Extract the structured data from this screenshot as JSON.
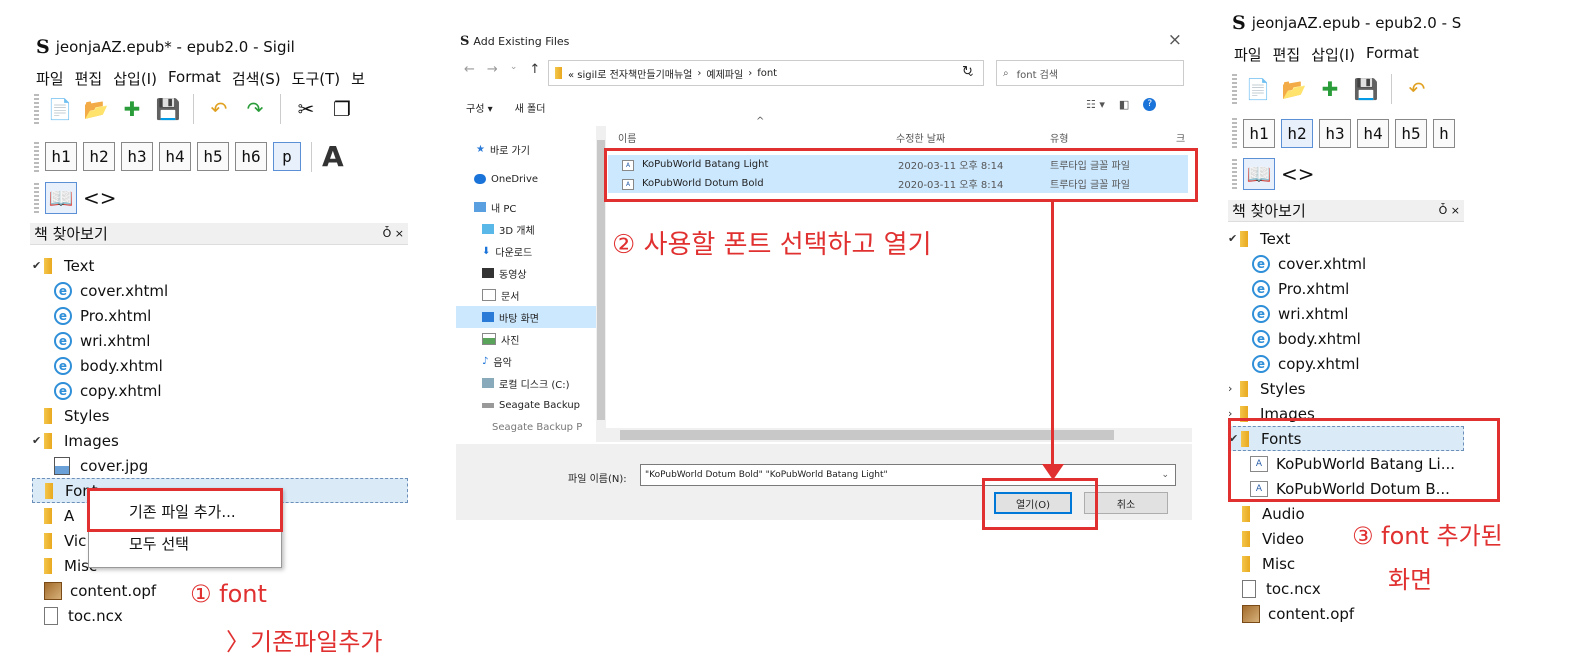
{
  "left_panel": {
    "app_title": "jeonjaAZ.epub* - epub2.0 - Sigil",
    "logo": "S",
    "menu": [
      "파일",
      "편집",
      "삽입(I)",
      "Format",
      "검색(S)",
      "도구(T)",
      "보"
    ],
    "heading_buttons": [
      "h1",
      "h2",
      "h3",
      "h4",
      "h5",
      "h6",
      "p"
    ],
    "big_a": "A",
    "code_view": "<>",
    "panel_title": "책 찾아보기",
    "panel_controls": "Ȱ ×",
    "tree": {
      "text_folder": "Text",
      "text_files": [
        "cover.xhtml",
        "Pro.xhtml",
        "wri.xhtml",
        "body.xhtml",
        "copy.xhtml"
      ],
      "styles": "Styles",
      "images": "Images",
      "image_files": [
        "cover.jpg"
      ],
      "fonts_partial": "Font",
      "audio_partial": "A",
      "video_partial": "Vic",
      "misc_partial": "Misc",
      "content_opf": "content.opf",
      "toc": "toc.ncx"
    },
    "context_menu": [
      "기존 파일 추가...",
      "모두 선택"
    ],
    "annotation_line1": "① font",
    "annotation_line2": "〉기존파일추가"
  },
  "dialog": {
    "logo": "S",
    "title": "Add Existing Files",
    "close": "×",
    "path": [
      "« sigil로 전자책만들기매뉴얼",
      "예제파일",
      "font"
    ],
    "search_placeholder": "font 검색",
    "organize": "구성 ▾",
    "new_folder": "새 폴더",
    "nav": [
      "바로 가기",
      "OneDrive",
      "내 PC",
      "3D 개체",
      "다운로드",
      "동영상",
      "문서",
      "바탕 화면",
      "사진",
      "음악",
      "로컬 디스크 (C:)",
      "Seagate Backup",
      "Seagate Backup P"
    ],
    "columns": [
      "이름",
      "수정한 날짜",
      "유형",
      "크"
    ],
    "files": [
      {
        "name": "KoPubWorld Batang Light",
        "date": "2020-03-11 오후 8:14",
        "type": "트루타입 글꼴 파일"
      },
      {
        "name": "KoPubWorld Dotum Bold",
        "date": "2020-03-11 오후 8:14",
        "type": "트루타입 글꼴 파일"
      }
    ],
    "filename_label": "파일 이름(N):",
    "filename_value": "\"KoPubWorld Dotum Bold\" \"KoPubWorld Batang Light\"",
    "open_button": "열기(O)",
    "cancel_button": "취소",
    "annotation": "② 사용할 폰트 선택하고 열기"
  },
  "right_panel": {
    "app_title": "jeonjaAZ.epub - epub2.0 - S",
    "logo": "S",
    "menu": [
      "파일",
      "편집",
      "삽입(I)",
      "Format"
    ],
    "heading_buttons": [
      "h1",
      "h2",
      "h3",
      "h4",
      "h5",
      "h"
    ],
    "code_view": "<>",
    "panel_title": "책 찾아보기",
    "panel_controls": "Ȱ ×",
    "tree": {
      "text_folder": "Text",
      "text_files": [
        "cover.xhtml",
        "Pro.xhtml",
        "wri.xhtml",
        "body.xhtml",
        "copy.xhtml"
      ],
      "styles": "Styles",
      "images": "Images",
      "fonts": "Fonts",
      "font_files": [
        "KoPubWorld Batang Li...",
        "KoPubWorld Dotum B..."
      ],
      "audio": "Audio",
      "video": "Video",
      "misc": "Misc",
      "toc": "toc.ncx",
      "content_opf": "content.opf"
    },
    "annotation_line1": "③ font 추가된",
    "annotation_line2": "화면"
  },
  "colors": {
    "annotation_red": "#e03030",
    "selection_blue": "#cce8ff",
    "folder_yellow": "#f3c64a"
  }
}
